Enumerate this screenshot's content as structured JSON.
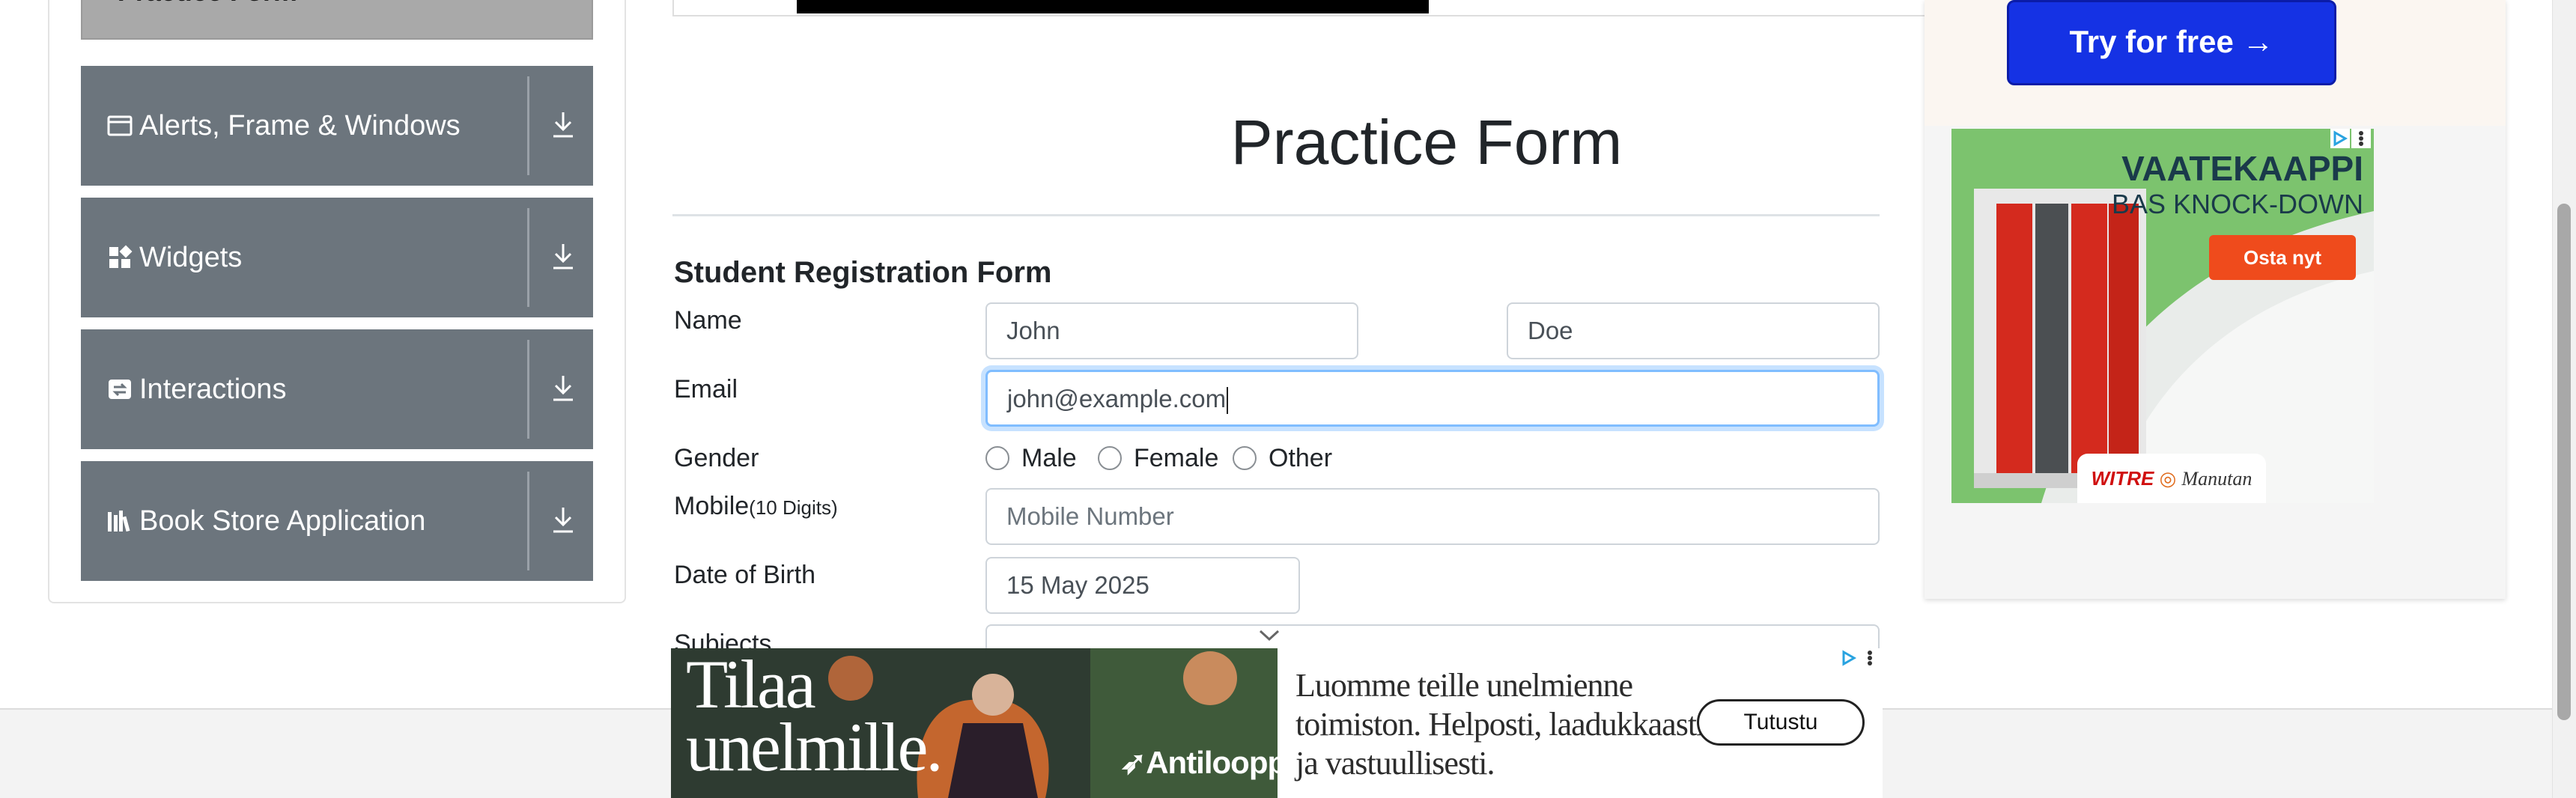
{
  "sidebar": {
    "current_item_partial": "Practice Form",
    "groups": [
      {
        "label": "Alerts, Frame & Windows",
        "icon": "window-icon"
      },
      {
        "label": "Widgets",
        "icon": "widgets-icon"
      },
      {
        "label": "Interactions",
        "icon": "interactions-icon"
      },
      {
        "label": "Book Store Application",
        "icon": "library-icon"
      }
    ]
  },
  "form": {
    "page_title": "Practice Form",
    "heading": "Student Registration Form",
    "name_label": "Name",
    "first_name": "John",
    "last_name": "Doe",
    "email_label": "Email",
    "email_value": "john@example.com",
    "gender_label": "Gender",
    "gender_options": [
      "Male",
      "Female",
      "Other"
    ],
    "mobile_label": "Mobile",
    "mobile_hint": "(10 Digits)",
    "mobile_placeholder": "Mobile Number",
    "dob_label": "Date of Birth",
    "dob_value": "15 May 2025",
    "subjects_label": "Subjects"
  },
  "ads": {
    "right_top_button": "Try for free →",
    "right_brand_line1": "VAATEKAAPPI",
    "right_brand_line2": "BAS KNOCK-DOWN",
    "right_cta": "Osta nyt",
    "right_logo1": "WITRE",
    "right_logo2": "Manutan",
    "bottom_headline_line1": "Tilaa",
    "bottom_headline_line2": "unelmille.",
    "bottom_brand": "Antilooppi",
    "bottom_copy": "Luomme teille unelmienne toimiston. Helposti, laadukkaasti ja vastuullisesti.",
    "bottom_cta": "Tutustu"
  },
  "colors": {
    "sidebar_header": "#6c757d",
    "focus_border": "#80bdff",
    "try_button": "#1532e4",
    "ad_green": "#7cc36e",
    "ad_cta": "#ef4b1c"
  },
  "scroll": {
    "thumb_fraction_start": 0.26,
    "thumb_fraction_size": 0.65
  }
}
